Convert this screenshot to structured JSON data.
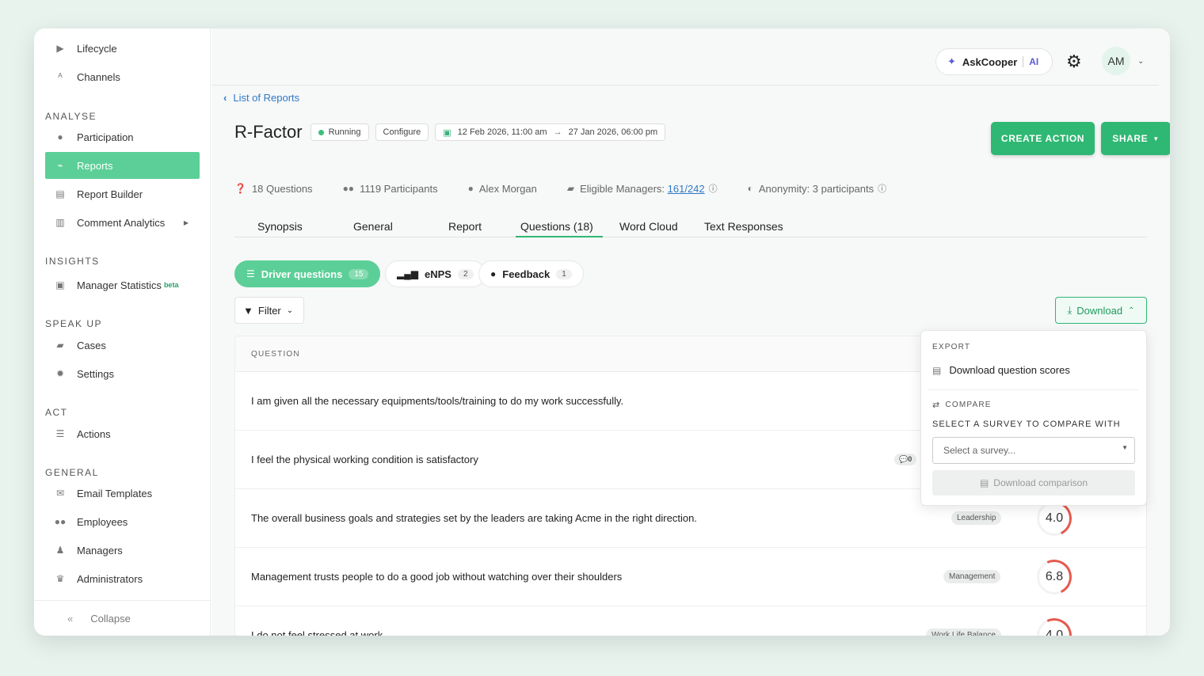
{
  "sidebar": {
    "top_items": [
      {
        "label": "Lifecycle",
        "icon": "lifecycle-icon"
      },
      {
        "label": "Channels",
        "icon": "channels-icon"
      }
    ],
    "sections": [
      {
        "label": "ANALYSE",
        "items": [
          {
            "label": "Participation"
          },
          {
            "label": "Reports",
            "active": true
          },
          {
            "label": "Report Builder"
          },
          {
            "label": "Comment Analytics"
          }
        ]
      },
      {
        "label": "INSIGHTS",
        "items": [
          {
            "label": "Manager Statistics",
            "badge": "beta"
          }
        ]
      },
      {
        "label": "SPEAK UP",
        "items": [
          {
            "label": "Cases"
          },
          {
            "label": "Settings"
          }
        ]
      },
      {
        "label": "ACT",
        "items": [
          {
            "label": "Actions"
          }
        ]
      },
      {
        "label": "GENERAL",
        "items": [
          {
            "label": "Email Templates"
          },
          {
            "label": "Employees"
          },
          {
            "label": "Managers"
          },
          {
            "label": "Administrators"
          }
        ]
      }
    ],
    "collapse_label": "Collapse"
  },
  "topbar": {
    "askcooper_label": "AskCooper",
    "ai_label": "AI",
    "avatar_initials": "AM"
  },
  "header": {
    "back_label": "List of Reports",
    "title": "R-Factor",
    "status": "Running",
    "configure_label": "Configure",
    "date_start": "12 Feb 2026, 11:00 am",
    "date_end": "27 Jan 2026, 06:00 pm",
    "create_action_label": "CREATE ACTION",
    "share_label": "SHARE"
  },
  "stats": {
    "questions": "18 Questions",
    "participants": "1119 Participants",
    "owner": "Alex Morgan",
    "eligible_label": "Eligible Managers:",
    "eligible_value": "161/242",
    "anonymity": "Anonymity: 3 participants"
  },
  "tabs": [
    "Synopsis",
    "General",
    "Report",
    "Questions (18)",
    "Word Cloud",
    "Text Responses"
  ],
  "pills": [
    {
      "label": "Driver questions",
      "count": "15"
    },
    {
      "label": "eNPS",
      "count": "2"
    },
    {
      "label": "Feedback",
      "count": "1"
    }
  ],
  "filter_label": "Filter",
  "download_label": "Download",
  "table": {
    "header": "QUESTION",
    "rows": [
      {
        "question": "I am given all the necessary equipments/tools/training to do my work successfully.",
        "tag": "",
        "score": ""
      },
      {
        "question": "I feel the physical working condition is satisfactory",
        "tag": "",
        "score": "",
        "comments": "0"
      },
      {
        "question": "The overall business goals and strategies set by the leaders are taking Acme in the right direction.",
        "tag": "Leadership",
        "score": "4.0"
      },
      {
        "question": "Management trusts people to do a good job without watching over their shoulders",
        "tag": "Management",
        "score": "6.8"
      },
      {
        "question": "I do not feel stressed at work",
        "tag": "Work Life Balance",
        "score": "4.0"
      }
    ]
  },
  "dropdown": {
    "export_label": "EXPORT",
    "download_scores_label": "Download question scores",
    "compare_label": "COMPARE",
    "select_survey_title": "SELECT A SURVEY TO COMPARE WITH",
    "select_placeholder": "Select a survey...",
    "download_comparison_label": "Download comparison"
  }
}
